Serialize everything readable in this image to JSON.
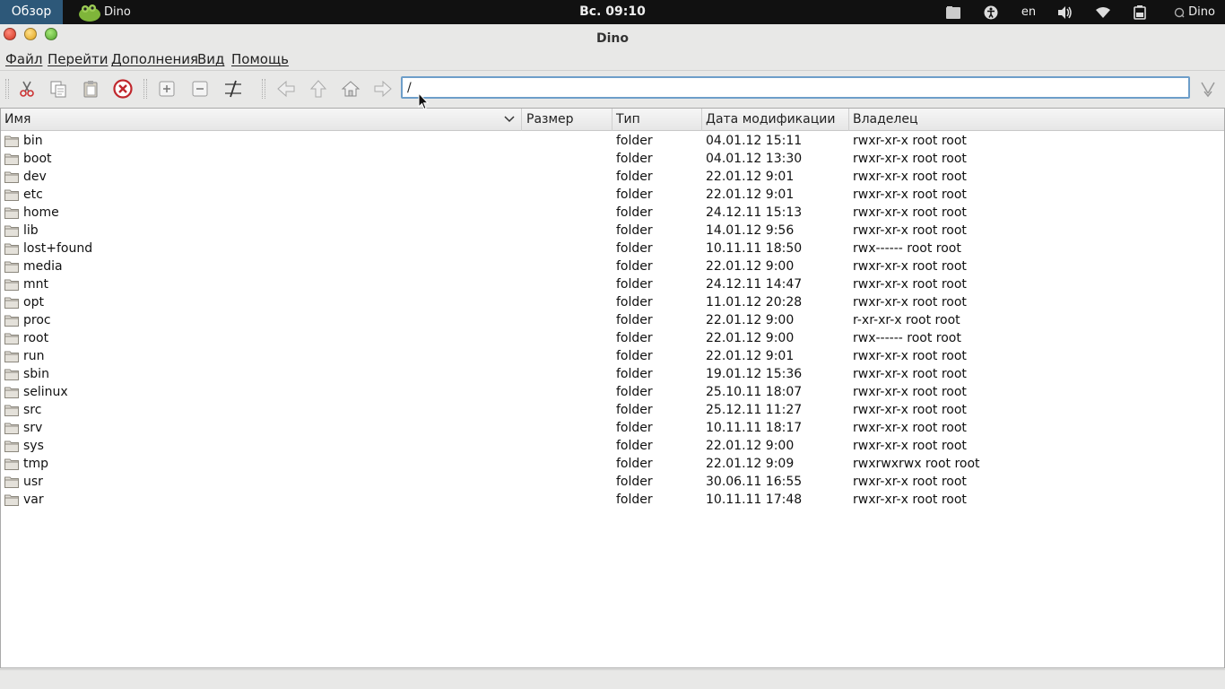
{
  "panel": {
    "activities": "Обзор",
    "app_name": "Dino",
    "clock": "Вс. 09:10",
    "keyboard_layout": "en",
    "user_menu": "Dino"
  },
  "window": {
    "title": "Dino"
  },
  "menubar": {
    "file": "Файл",
    "go": "Перейти",
    "extras": "Дополнения",
    "view": "Вид",
    "help": "Помощь"
  },
  "toolbar": {
    "icons": [
      "cut-icon",
      "copy-icon",
      "paste-icon",
      "delete-icon",
      "new-folder-icon",
      "remove-icon",
      "rename-icon",
      "back-icon",
      "up-icon",
      "home-icon",
      "forward-icon",
      "go-icon"
    ],
    "location_value": "/"
  },
  "columns": {
    "name": "Имя",
    "size": "Размер",
    "type": "Тип",
    "modified": "Дата модификации",
    "owner": "Владелец"
  },
  "files": [
    {
      "name": "bin",
      "type": "folder",
      "modified": "04.01.12 15:11",
      "owner": "rwxr-xr-x root root"
    },
    {
      "name": "boot",
      "type": "folder",
      "modified": "04.01.12 13:30",
      "owner": "rwxr-xr-x root root"
    },
    {
      "name": "dev",
      "type": "folder",
      "modified": "22.01.12 9:01",
      "owner": "rwxr-xr-x root root"
    },
    {
      "name": "etc",
      "type": "folder",
      "modified": "22.01.12 9:01",
      "owner": "rwxr-xr-x root root"
    },
    {
      "name": "home",
      "type": "folder",
      "modified": "24.12.11 15:13",
      "owner": "rwxr-xr-x root root"
    },
    {
      "name": "lib",
      "type": "folder",
      "modified": "14.01.12 9:56",
      "owner": "rwxr-xr-x root root"
    },
    {
      "name": "lost+found",
      "type": "folder",
      "modified": "10.11.11 18:50",
      "owner": "rwx------ root root"
    },
    {
      "name": "media",
      "type": "folder",
      "modified": "22.01.12 9:00",
      "owner": "rwxr-xr-x root root"
    },
    {
      "name": "mnt",
      "type": "folder",
      "modified": "24.12.11 14:47",
      "owner": "rwxr-xr-x root root"
    },
    {
      "name": "opt",
      "type": "folder",
      "modified": "11.01.12 20:28",
      "owner": "rwxr-xr-x root root"
    },
    {
      "name": "proc",
      "type": "folder",
      "modified": "22.01.12 9:00",
      "owner": "r-xr-xr-x root root"
    },
    {
      "name": "root",
      "type": "folder",
      "modified": "22.01.12 9:00",
      "owner": "rwx------ root root"
    },
    {
      "name": "run",
      "type": "folder",
      "modified": "22.01.12 9:01",
      "owner": "rwxr-xr-x root root"
    },
    {
      "name": "sbin",
      "type": "folder",
      "modified": "19.01.12 15:36",
      "owner": "rwxr-xr-x root root"
    },
    {
      "name": "selinux",
      "type": "folder",
      "modified": "25.10.11 18:07",
      "owner": "rwxr-xr-x root root"
    },
    {
      "name": "src",
      "type": "folder",
      "modified": "25.12.11 11:27",
      "owner": "rwxr-xr-x root root"
    },
    {
      "name": "srv",
      "type": "folder",
      "modified": "10.11.11 18:17",
      "owner": "rwxr-xr-x root root"
    },
    {
      "name": "sys",
      "type": "folder",
      "modified": "22.01.12 9:00",
      "owner": "rwxr-xr-x root root"
    },
    {
      "name": "tmp",
      "type": "folder",
      "modified": "22.01.12 9:09",
      "owner": "rwxrwxrwx root root"
    },
    {
      "name": "usr",
      "type": "folder",
      "modified": "30.06.11 16:55",
      "owner": "rwxr-xr-x root root"
    },
    {
      "name": "var",
      "type": "folder",
      "modified": "10.11.11 17:48",
      "owner": "rwxr-xr-x root root"
    }
  ],
  "colors": {
    "activities_bg": "#2d5879",
    "panel_bg": "#111111",
    "window_bg": "#e8e8e7",
    "location_border": "#6d9ec9",
    "folder_icon": "#b9b4a8"
  }
}
